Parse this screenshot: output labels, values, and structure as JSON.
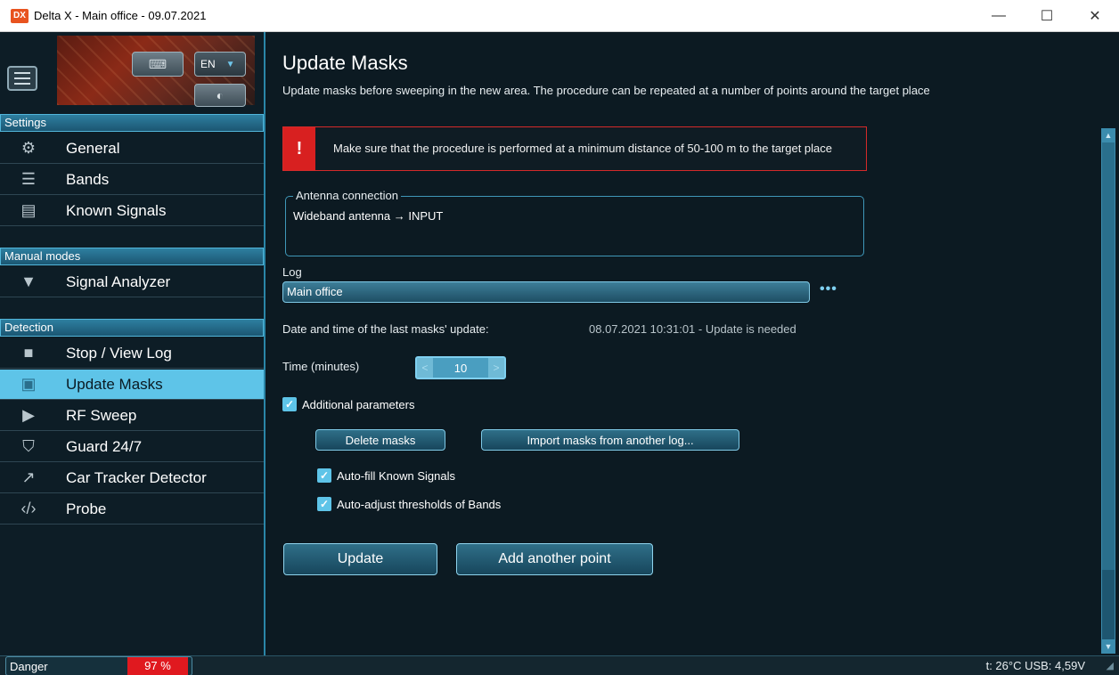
{
  "window": {
    "app_icon_label": "DX",
    "title": "Delta X - Main office - 09.07.2021",
    "minimize": "—",
    "maximize": "☐",
    "close": "✕"
  },
  "sidebar": {
    "lang": "EN",
    "sections": {
      "settings": "Settings",
      "manual_modes": "Manual modes",
      "detection": "Detection"
    },
    "items": [
      {
        "label": "General",
        "icon": "gear-icon"
      },
      {
        "label": "Bands",
        "icon": "list-icon"
      },
      {
        "label": "Known Signals",
        "icon": "clipboard-icon"
      },
      {
        "label": "Signal Analyzer",
        "icon": "signal-icon"
      },
      {
        "label": "Stop / View Log",
        "icon": "stop-icon"
      },
      {
        "label": "Update Masks",
        "icon": "image-icon",
        "active": true
      },
      {
        "label": "RF Sweep",
        "icon": "play-icon"
      },
      {
        "label": "Guard 24/7",
        "icon": "shield-icon"
      },
      {
        "label": "Car Tracker Detector",
        "icon": "trend-icon"
      },
      {
        "label": "Probe",
        "icon": "code-icon"
      }
    ]
  },
  "main": {
    "title": "Update Masks",
    "subtitle": "Update masks before sweeping in the new area. The procedure can be repeated at a number of points around the target place",
    "warning": {
      "icon": "!",
      "text": "Make sure that the procedure is performed at a minimum distance of 50-100 m to the target place"
    },
    "antenna": {
      "legend": "Antenna connection",
      "text": "Wideband antenna → INPUT"
    },
    "log": {
      "label": "Log",
      "value": "Main office",
      "more": "•••"
    },
    "last_update": {
      "label": "Date and time of the last masks' update:",
      "value": "08.07.2021 10:31:01 - Update is needed"
    },
    "time": {
      "label": "Time (minutes)",
      "value": "10",
      "dec": "<",
      "inc": ">"
    },
    "additional_parameters": {
      "label": "Additional parameters",
      "checked": true
    },
    "delete_masks": "Delete masks",
    "import_masks": "Import masks from another log...",
    "auto_fill": {
      "label": "Auto-fill Known Signals",
      "checked": true
    },
    "auto_adjust": {
      "label": "Auto-adjust thresholds of Bands",
      "checked": true
    },
    "update_button": "Update",
    "add_point_button": "Add another point"
  },
  "statusbar": {
    "danger_label": "Danger",
    "danger_value": "97 %",
    "right_text": "t: 26°C  USB: 4,59V"
  },
  "colors": {
    "accent": "#5ec4e8",
    "danger": "#e0191f",
    "warning_border": "#d42a2a"
  }
}
